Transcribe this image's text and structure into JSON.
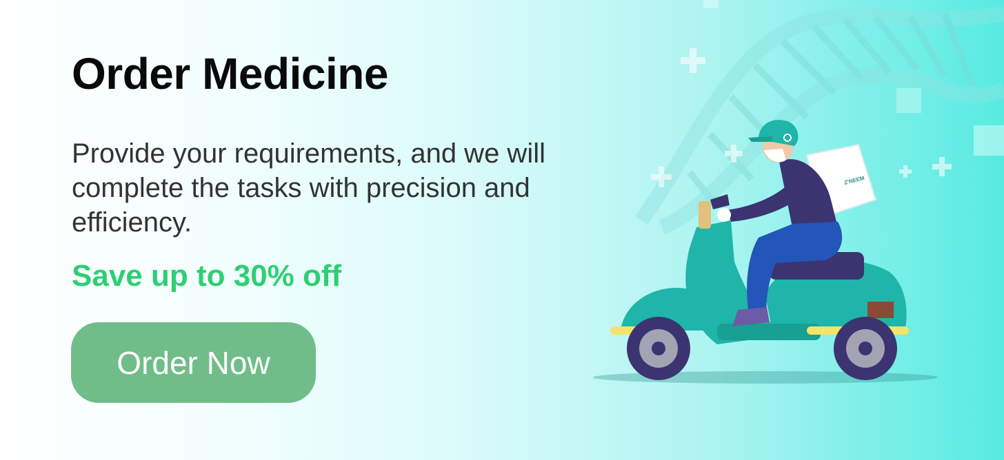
{
  "title": "Order Medicine",
  "description": "Provide your requirements, and we will complete the tasks with precision and efficiency.",
  "promo": "Save up to 30% off",
  "cta_label": "Order Now",
  "bag_logo_text": "Z'NEEM",
  "colors": {
    "accent_green": "#2ecf72",
    "button_green": "#70bd8a",
    "scooter_teal": "#1fb5a8",
    "rider_purple": "#3b3470",
    "background_teal": "#57ebe2"
  },
  "icons": [
    "dna-helix-icon",
    "medical-cross-icon",
    "delivery-scooter-icon"
  ]
}
